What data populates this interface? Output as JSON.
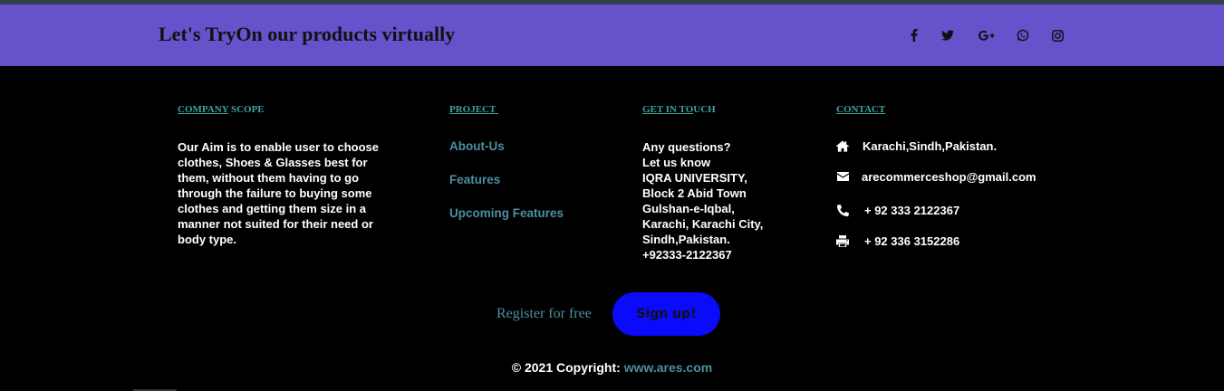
{
  "banner": {
    "title": "Let's TryOn our products virtually",
    "social_icons": [
      "facebook-icon",
      "twitter-icon",
      "google-plus-icon",
      "whatsapp-icon",
      "instagram-icon"
    ]
  },
  "company": {
    "heading_underlined": "COMPANY",
    "heading_rest": " SCOPE",
    "about": "Our Aim is to enable user to choose clothes, Shoes & Glasses best for them, without them having to go through the failure to buying some clothes and getting them size in a manner not suited for their need or body type."
  },
  "project": {
    "heading": "PROJECT",
    "links": [
      "About-Us",
      "Features",
      "Upcoming Features"
    ]
  },
  "touch": {
    "heading_underlined": "GET IN TO",
    "heading_rest": "UCH",
    "lines": [
      "Any questions?",
      "Let us know",
      "IQRA UNIVERSITY,",
      "Block 2 Abid Town",
      "Gulshan-e-Iqbal,",
      "Karachi, Karachi City,",
      "Sindh,Pakistan.",
      "+92333-2122367"
    ]
  },
  "contact": {
    "heading": "CONTACT",
    "address": "Karachi,Sindh,Pakistan.",
    "email": "arecommerceshop@gmail.com",
    "phone": "+ 92 333 2122367",
    "fax": "+ 92 336 3152286"
  },
  "cta": {
    "register_text": "Register for free",
    "signup_label": "Sign up!"
  },
  "footer": {
    "copyright_prefix": "© 2021 Copyright: ",
    "site_link": "www.ares.com"
  },
  "colors": {
    "banner": "#6652cb",
    "accent": "#4c8fa0",
    "heading": "#3fa1a0",
    "signup": "#0a0afc"
  }
}
